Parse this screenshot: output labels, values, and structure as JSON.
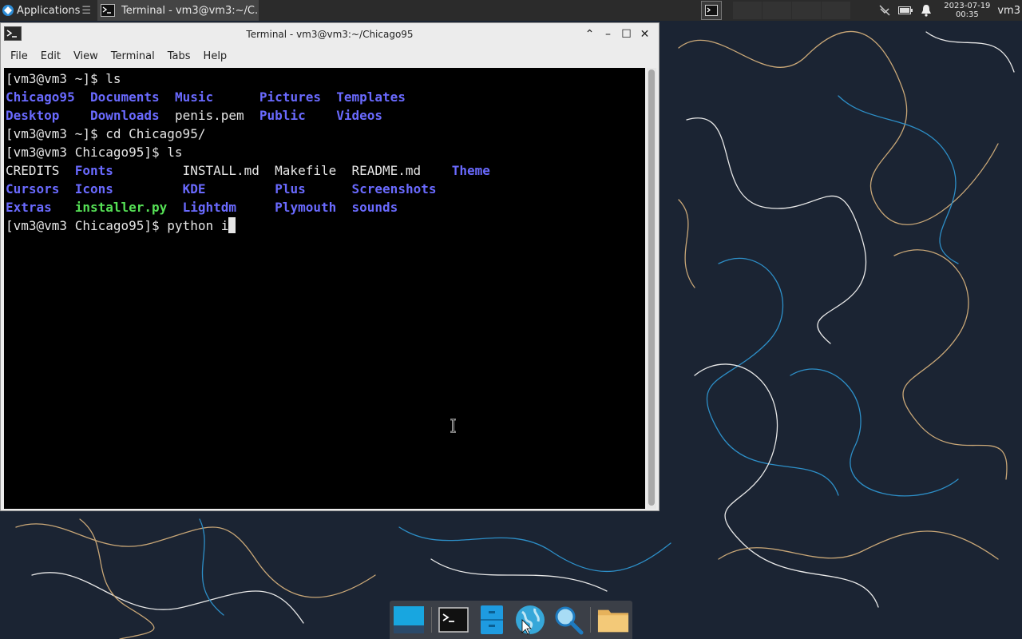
{
  "panel": {
    "applications_label": "Applications",
    "task_label": "Terminal - vm3@vm3:~/C...",
    "clock_date": "2023-07-19",
    "clock_time": "00:35",
    "user": "vm3"
  },
  "window": {
    "title": "Terminal - vm3@vm3:~/Chicago95",
    "menu": [
      "File",
      "Edit",
      "View",
      "Terminal",
      "Tabs",
      "Help"
    ]
  },
  "terminal": {
    "lines": [
      [
        {
          "t": "[vm3@vm3 ~]$ ls",
          "k": "plain"
        }
      ],
      [
        {
          "t": "Chicago95",
          "k": "dir"
        },
        {
          "t": "  ",
          "k": "plain"
        },
        {
          "t": "Documents",
          "k": "dir"
        },
        {
          "t": "  ",
          "k": "plain"
        },
        {
          "t": "Music",
          "k": "dir"
        },
        {
          "t": "      ",
          "k": "plain"
        },
        {
          "t": "Pictures",
          "k": "dir"
        },
        {
          "t": "  ",
          "k": "plain"
        },
        {
          "t": "Templates",
          "k": "dir"
        }
      ],
      [
        {
          "t": "Desktop",
          "k": "dir"
        },
        {
          "t": "    ",
          "k": "plain"
        },
        {
          "t": "Downloads",
          "k": "dir"
        },
        {
          "t": "  penis.pem  ",
          "k": "plain"
        },
        {
          "t": "Public",
          "k": "dir"
        },
        {
          "t": "    ",
          "k": "plain"
        },
        {
          "t": "Videos",
          "k": "dir"
        }
      ],
      [
        {
          "t": "[vm3@vm3 ~]$ cd Chicago95/",
          "k": "plain"
        }
      ],
      [
        {
          "t": "[vm3@vm3 Chicago95]$ ls",
          "k": "plain"
        }
      ],
      [
        {
          "t": "CREDITS  ",
          "k": "plain"
        },
        {
          "t": "Fonts",
          "k": "dir"
        },
        {
          "t": "         INSTALL.md  Makefile  README.md    ",
          "k": "plain"
        },
        {
          "t": "Theme",
          "k": "dir"
        }
      ],
      [
        {
          "t": "Cursors",
          "k": "dir"
        },
        {
          "t": "  ",
          "k": "plain"
        },
        {
          "t": "Icons",
          "k": "dir"
        },
        {
          "t": "         ",
          "k": "plain"
        },
        {
          "t": "KDE",
          "k": "dir"
        },
        {
          "t": "         ",
          "k": "plain"
        },
        {
          "t": "Plus",
          "k": "dir"
        },
        {
          "t": "      ",
          "k": "plain"
        },
        {
          "t": "Screenshots",
          "k": "dir"
        }
      ],
      [
        {
          "t": "Extras",
          "k": "dir"
        },
        {
          "t": "   ",
          "k": "plain"
        },
        {
          "t": "installer.py",
          "k": "exe"
        },
        {
          "t": "  ",
          "k": "plain"
        },
        {
          "t": "Lightdm",
          "k": "dir"
        },
        {
          "t": "     ",
          "k": "plain"
        },
        {
          "t": "Plymouth",
          "k": "dir"
        },
        {
          "t": "  ",
          "k": "plain"
        },
        {
          "t": "sounds",
          "k": "dir"
        }
      ],
      [
        {
          "t": "[vm3@vm3 Chicago95]$ python i",
          "k": "plain"
        }
      ]
    ]
  },
  "colors": {
    "dir": "#6a6aff",
    "exe": "#55e055",
    "desktop_bg": "#1b2433"
  },
  "dock": [
    "desktop-icon",
    "terminal-icon",
    "file-cabinet-icon",
    "web-browser-icon",
    "search-icon",
    "folder-icon"
  ]
}
